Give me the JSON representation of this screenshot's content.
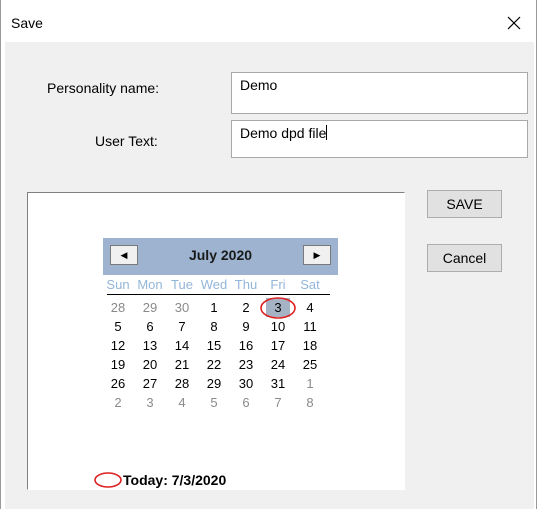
{
  "window": {
    "title": "Save"
  },
  "form": {
    "personality_label": "Personality name:",
    "personality_value": "Demo",
    "user_text_label": "User Text:",
    "user_text_value": "Demo dpd file"
  },
  "buttons": {
    "save": "SAVE",
    "cancel": "Cancel"
  },
  "calendar": {
    "month_label": "July 2020",
    "prev_glyph": "◀",
    "next_glyph": "▶",
    "weekdays": [
      "Sun",
      "Mon",
      "Tue",
      "Wed",
      "Thu",
      "Fri",
      "Sat"
    ],
    "weeks": [
      [
        "28",
        "29",
        "30",
        "1",
        "2",
        "3",
        "4"
      ],
      [
        "5",
        "6",
        "7",
        "8",
        "9",
        "10",
        "11"
      ],
      [
        "12",
        "13",
        "14",
        "15",
        "16",
        "17",
        "18"
      ],
      [
        "19",
        "20",
        "21",
        "22",
        "23",
        "24",
        "25"
      ],
      [
        "26",
        "27",
        "28",
        "29",
        "30",
        "31",
        "1"
      ],
      [
        "2",
        "3",
        "4",
        "5",
        "6",
        "7",
        "8"
      ]
    ],
    "selected_day": "3",
    "today_label": "Today: 7/3/2020",
    "colors": {
      "header": "#9db3cf",
      "weekday_text": "#93b5d8",
      "selected_bg": "#a6b3c5",
      "today_circle": "#e02020",
      "other_month_text": "#8a8a8a"
    }
  }
}
